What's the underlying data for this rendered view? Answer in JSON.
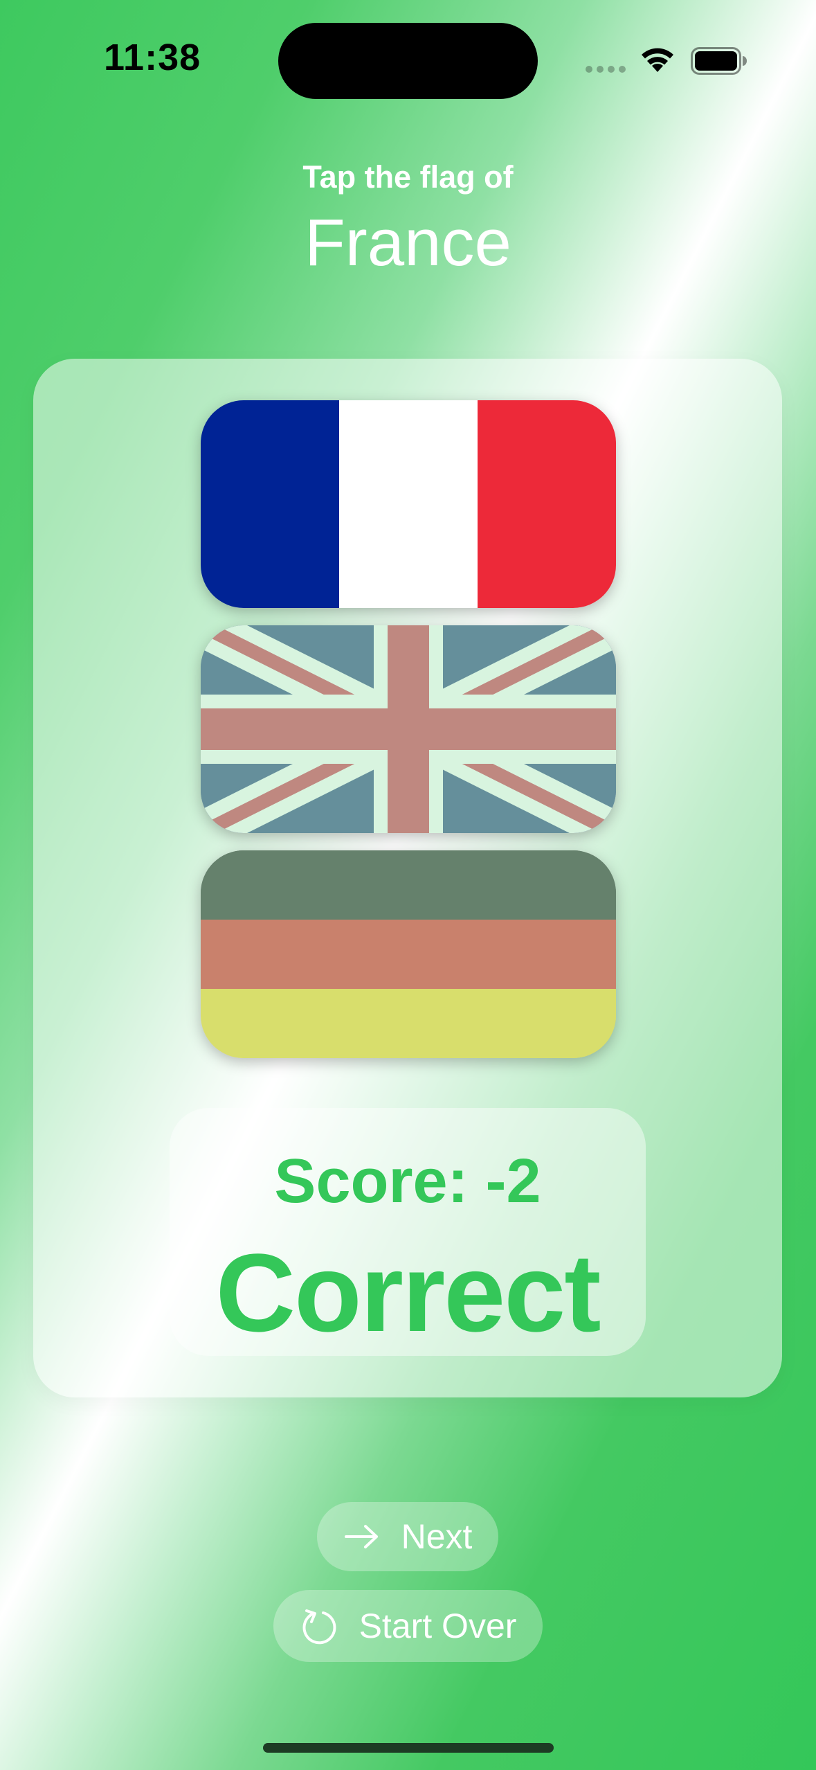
{
  "status_bar": {
    "time": "11:38",
    "icons": [
      "cellular-signal-icon",
      "wifi-icon",
      "battery-icon"
    ]
  },
  "prompt": {
    "instruction": "Tap the flag of",
    "country": "France"
  },
  "flags": [
    {
      "name": "france-flag",
      "colors": [
        "#002395",
        "#ffffff",
        "#ed2939"
      ],
      "state": "highlighted"
    },
    {
      "name": "uk-flag",
      "colors": [
        "#012169",
        "#ffffff",
        "#c8102e"
      ],
      "state": "dimmed"
    },
    {
      "name": "germany-flag",
      "colors": [
        "#000000",
        "#dd0000",
        "#ffce00"
      ],
      "state": "dimmed"
    }
  ],
  "result": {
    "score_text": "Score: -2",
    "status_text": "Correct"
  },
  "buttons": {
    "next_label": "Next",
    "next_icon": "arrow-right-icon",
    "start_over_label": "Start Over",
    "start_over_icon": "restart-icon"
  },
  "colors": {
    "accent_green": "#34c759",
    "text_white": "#ffffff"
  }
}
